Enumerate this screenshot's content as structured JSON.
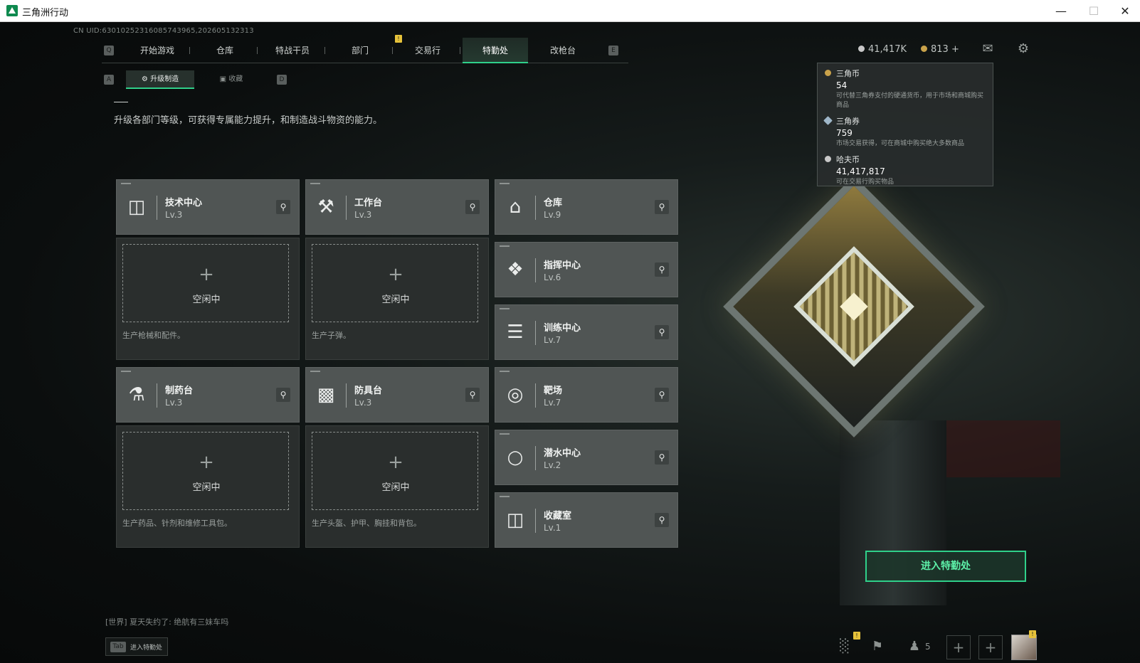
{
  "window": {
    "title": "三角洲行动"
  },
  "uid": "CN UID:630102523160857439​65,202605132313",
  "nav": {
    "left_key": "Q",
    "right_key": "E",
    "tabs": [
      {
        "label": "开始游戏"
      },
      {
        "label": "仓库"
      },
      {
        "label": "特战干员"
      },
      {
        "label": "部门"
      },
      {
        "label": "交易行"
      },
      {
        "label": "特勤处"
      },
      {
        "label": "改枪台"
      }
    ],
    "active_tab": "特勤处"
  },
  "subnav": {
    "left_key": "A",
    "right_key": "D",
    "tabs": [
      {
        "label": "升级制造"
      },
      {
        "label": "收藏"
      }
    ]
  },
  "currencies": {
    "hafu_short": "41,417K",
    "coupon_short": "813",
    "add_symbol": "+"
  },
  "tooltip": {
    "items": [
      {
        "name": "三角币",
        "value": "54",
        "desc": "可代替三角券支付的硬通货币，用于市场和商城购买商品",
        "color": "#c9a24a"
      },
      {
        "name": "三角券",
        "value": "759",
        "desc": "市场交易获得，可在商城中购买绝大多数商品",
        "color": "#9fb7c9"
      },
      {
        "name": "哈夫币",
        "value": "41,417,817",
        "desc": "可在交易行购买物品",
        "color": "#c8c8c8"
      }
    ]
  },
  "description": "升级各部门等级，可获得专属能力提升，和制造战斗物资的能力。",
  "facilities": [
    {
      "name": "技术中心",
      "level": "Lv.3",
      "icon": "monitor-icon"
    },
    {
      "name": "工作台",
      "level": "Lv.3",
      "icon": "tools-icon"
    },
    {
      "name": "仓库",
      "level": "Lv.9",
      "icon": "warehouse-icon"
    },
    {
      "name": "指挥中心",
      "level": "Lv.6",
      "icon": "command-icon"
    },
    {
      "name": "训练中心",
      "level": "Lv.7",
      "icon": "dumbbell-icon"
    },
    {
      "name": "制药台",
      "level": "Lv.3",
      "icon": "microscope-icon"
    },
    {
      "name": "防具台",
      "level": "Lv.3",
      "icon": "armor-icon"
    },
    {
      "name": "靶场",
      "level": "Lv.7",
      "icon": "target-icon"
    },
    {
      "name": "潜水中心",
      "level": "Lv.2",
      "icon": "diving-icon"
    },
    {
      "name": "收藏室",
      "level": "Lv.1",
      "icon": "collection-icon"
    }
  ],
  "slots": [
    {
      "status": "空闲中",
      "desc": "生产枪械和配件。"
    },
    {
      "status": "空闲中",
      "desc": "生产子弹。"
    },
    {
      "status": "空闲中",
      "desc": "生产药品、针剂和维修工具包。"
    },
    {
      "status": "空闲中",
      "desc": "生产头盔、护甲、胸挂和背包。"
    }
  ],
  "enter_button": "进入特勤处",
  "chat": {
    "channel": "[世界]",
    "message": "夏天失约了: 绝航有三妹车吗"
  },
  "tab_hint": {
    "key": "Tab",
    "label": "进入特勤处"
  },
  "friends_count": "5",
  "colors": {
    "accent": "#2fd08a",
    "alert": "#e6c23a"
  }
}
